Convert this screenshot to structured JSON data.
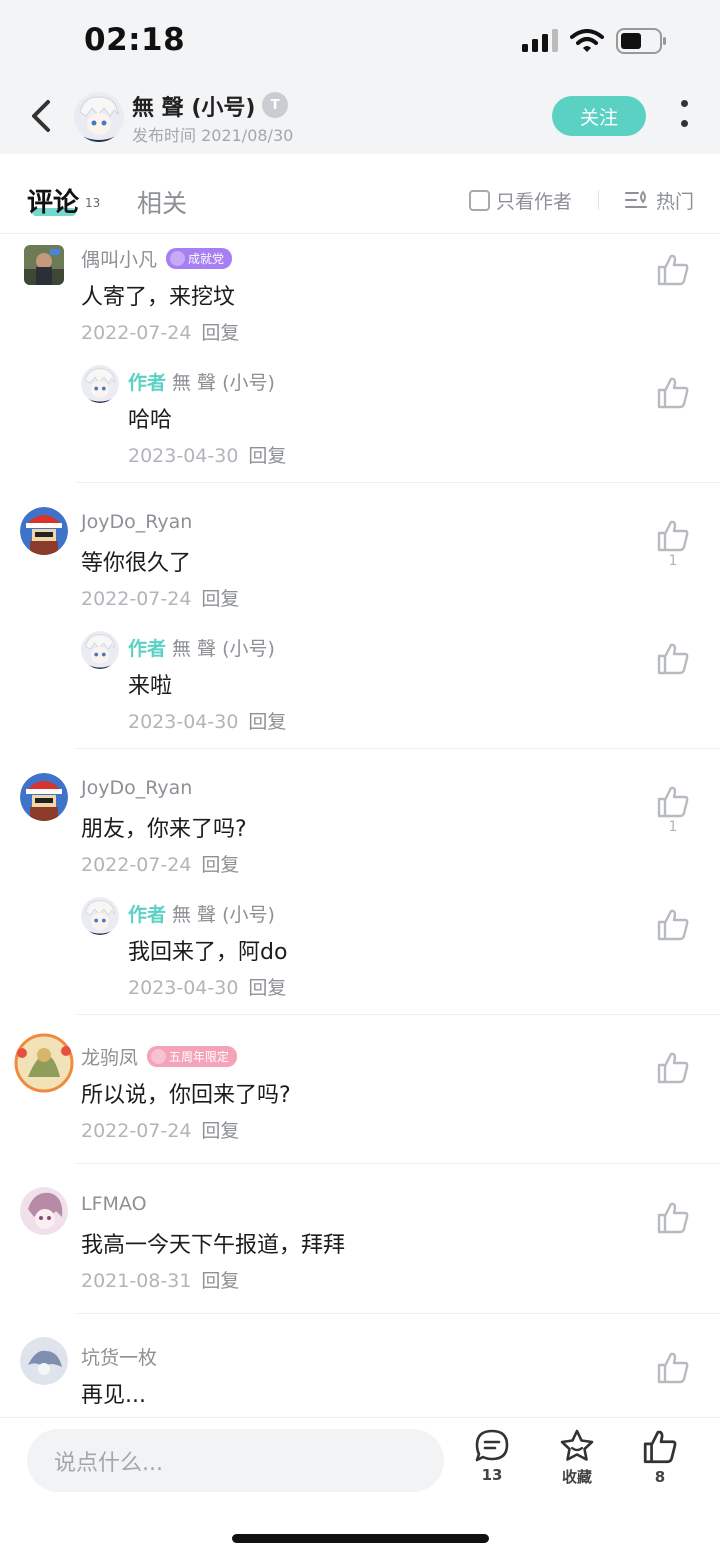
{
  "status_bar": {
    "time": "02:18"
  },
  "header": {
    "author_name": "無 聲 (小号)",
    "author_level_badge": "T",
    "publish_date": "发布时间 2021/08/30",
    "follow_label": "关注"
  },
  "tabs": {
    "comments_label": "评论",
    "comments_count": "13",
    "related_label": "相关",
    "only_author_label": "只看作者",
    "sort_label": "热门"
  },
  "comments": [
    {
      "user": "偶叫小凡",
      "tag": "成就党",
      "tag_color": "#a77ff2",
      "text": "人寄了，来挖坟",
      "date": "2022-07-24",
      "reply_label": "回复",
      "likes": "",
      "reply": {
        "role": "作者",
        "user": "無 聲 (小号)",
        "text": "哈哈",
        "date": "2023-04-30",
        "reply_label": "回复",
        "likes": ""
      }
    },
    {
      "user": "JoyDo_Ryan",
      "tag": "",
      "text": "等你很久了",
      "date": "2022-07-24",
      "reply_label": "回复",
      "likes": "1",
      "reply": {
        "role": "作者",
        "user": "無 聲 (小号)",
        "text": "来啦",
        "date": "2023-04-30",
        "reply_label": "回复",
        "likes": ""
      }
    },
    {
      "user": "JoyDo_Ryan",
      "tag": "",
      "text": "朋友，你来了吗?",
      "date": "2022-07-24",
      "reply_label": "回复",
      "likes": "1",
      "reply": {
        "role": "作者",
        "user": "無 聲 (小号)",
        "text": "我回来了，阿do",
        "date": "2023-04-30",
        "reply_label": "回复",
        "likes": ""
      }
    },
    {
      "user": "龙驹凤",
      "tag": "五周年限定",
      "tag_color": "#f5a3b8",
      "text": "所以说，你回来了吗?",
      "date": "2022-07-24",
      "reply_label": "回复",
      "likes": ""
    },
    {
      "user": "LFMAO",
      "tag": "",
      "text": "我高一今天下午报道，拜拜",
      "date": "2021-08-31",
      "reply_label": "回复",
      "likes": ""
    },
    {
      "user": "坑货一枚",
      "tag": "",
      "text": "再见...",
      "date": "",
      "reply_label": "",
      "likes": ""
    }
  ],
  "bottom_bar": {
    "input_placeholder": "说点什么...",
    "comment_count": "13",
    "favorite_label": "收藏",
    "like_count": "8"
  },
  "colors": {
    "accent": "#5bd1c4",
    "text_primary": "#1c1c1c",
    "text_secondary": "#8d9196",
    "text_tertiary": "#b1b5ba"
  },
  "icons": [
    "back-icon",
    "more-icon",
    "checkbox-icon",
    "sort-icon",
    "thumb-up-icon",
    "comment-icon",
    "star-icon"
  ]
}
